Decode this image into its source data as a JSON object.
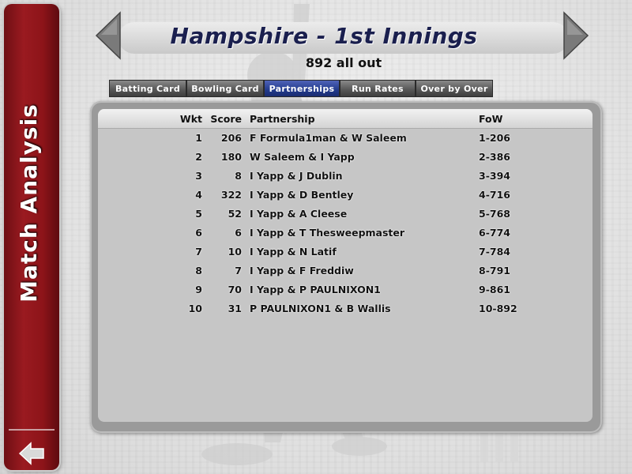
{
  "sidebar": {
    "title": "Match Analysis"
  },
  "header": {
    "title": "Hampshire - 1st Innings",
    "subtitle": "892 all out"
  },
  "tabs": [
    {
      "label": "Batting Card",
      "active": false
    },
    {
      "label": "Bowling Card",
      "active": false
    },
    {
      "label": "Partnerships",
      "active": true
    },
    {
      "label": "Run Rates",
      "active": false
    },
    {
      "label": "Over by Over",
      "active": false
    }
  ],
  "table": {
    "headers": {
      "wkt": "Wkt",
      "score": "Score",
      "partnership": "Partnership",
      "fow": "FoW"
    },
    "rows": [
      {
        "wkt": "1",
        "score": "206",
        "partnership": "F Formula1man & W Saleem",
        "fow": "1-206"
      },
      {
        "wkt": "2",
        "score": "180",
        "partnership": "W Saleem & I Yapp",
        "fow": "2-386"
      },
      {
        "wkt": "3",
        "score": "8",
        "partnership": "I Yapp & J Dublin",
        "fow": "3-394"
      },
      {
        "wkt": "4",
        "score": "322",
        "partnership": "I Yapp & D Bentley",
        "fow": "4-716"
      },
      {
        "wkt": "5",
        "score": "52",
        "partnership": "I Yapp & A Cleese",
        "fow": "5-768"
      },
      {
        "wkt": "6",
        "score": "6",
        "partnership": "I Yapp & T Thesweepmaster",
        "fow": "6-774"
      },
      {
        "wkt": "7",
        "score": "10",
        "partnership": "I Yapp & N Latif",
        "fow": "7-784"
      },
      {
        "wkt": "8",
        "score": "7",
        "partnership": "I Yapp & F Freddiw",
        "fow": "8-791"
      },
      {
        "wkt": "9",
        "score": "70",
        "partnership": "I Yapp & P PAULNIXON1",
        "fow": "9-861"
      },
      {
        "wkt": "10",
        "score": "31",
        "partnership": "P PAULNIXON1 & B Wallis",
        "fow": "10-892"
      }
    ]
  },
  "colors": {
    "sidebar": "#8d1419",
    "title": "#1a1f4e",
    "active_tab": "#223a8c",
    "tab": "#555555"
  },
  "icons": {
    "back": "arrow-left-icon",
    "prev": "triangle-left-icon",
    "next": "triangle-right-icon"
  }
}
